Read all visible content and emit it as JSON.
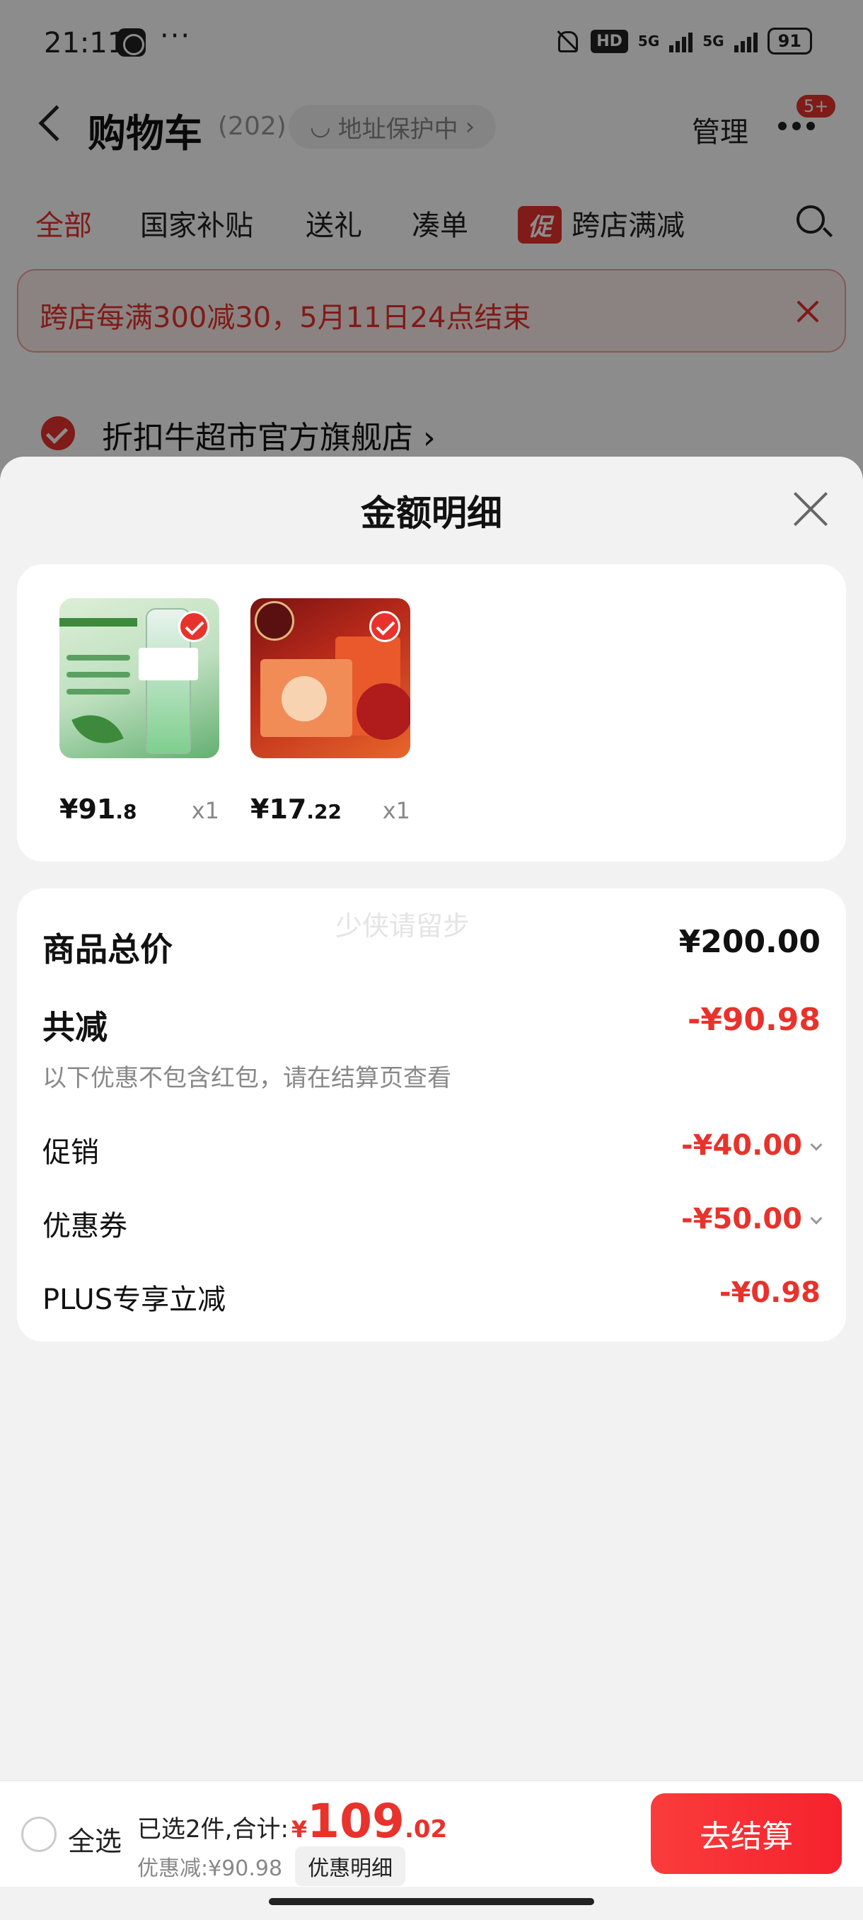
{
  "status_bar": {
    "time": "21:11",
    "more": "···",
    "hd": "HD",
    "network1": "5G",
    "network2": "5G",
    "battery": "91"
  },
  "header": {
    "back_icon": "chevron-left-icon",
    "title": "购物车",
    "count": "(202)",
    "address_protect": "地址保护中",
    "manage": "管理",
    "more_badge": "5+"
  },
  "tabs": [
    {
      "label": "全部",
      "active": true
    },
    {
      "label": "国家补贴",
      "active": false
    },
    {
      "label": "送礼",
      "active": false
    },
    {
      "label": "凑单",
      "active": false
    },
    {
      "label": "跨店满减",
      "active": false,
      "tag": "促"
    }
  ],
  "notice": {
    "text": "跨店每满300减30，5月11日24点结束"
  },
  "store": {
    "name": "折扣牛超市官方旗舰店 ›"
  },
  "sheet": {
    "title": "金额明细",
    "products": [
      {
        "price_int": "¥91",
        "price_dec": ".8",
        "qty": "x1",
        "checked": true
      },
      {
        "price_int": "¥17",
        "price_dec": ".22",
        "qty": "x1",
        "checked": true
      }
    ],
    "watermark": "少侠请留步",
    "total_label": "商品总价",
    "total_value": "¥200.00",
    "reduce_label": "共减",
    "reduce_value": "-¥90.98",
    "reduce_note": "以下优惠不包含红包，请在结算页查看",
    "items": [
      {
        "label": "促销",
        "value": "-¥40.00",
        "expandable": true
      },
      {
        "label": "优惠券",
        "value": "-¥50.00",
        "expandable": true
      },
      {
        "label": "PLUS专享立减",
        "value": "-¥0.98",
        "expandable": false
      }
    ]
  },
  "bottom_bar": {
    "select_all": "全选",
    "selected_text": "已选2件,合计:",
    "currency": "¥",
    "total_int": "109",
    "total_dec": ".02",
    "discount_text": "优惠减:¥90.98",
    "detail_button": "优惠明细",
    "checkout": "去结算"
  },
  "colors": {
    "accent": "#e8322c",
    "sheet_bg": "#f2f2f2"
  }
}
